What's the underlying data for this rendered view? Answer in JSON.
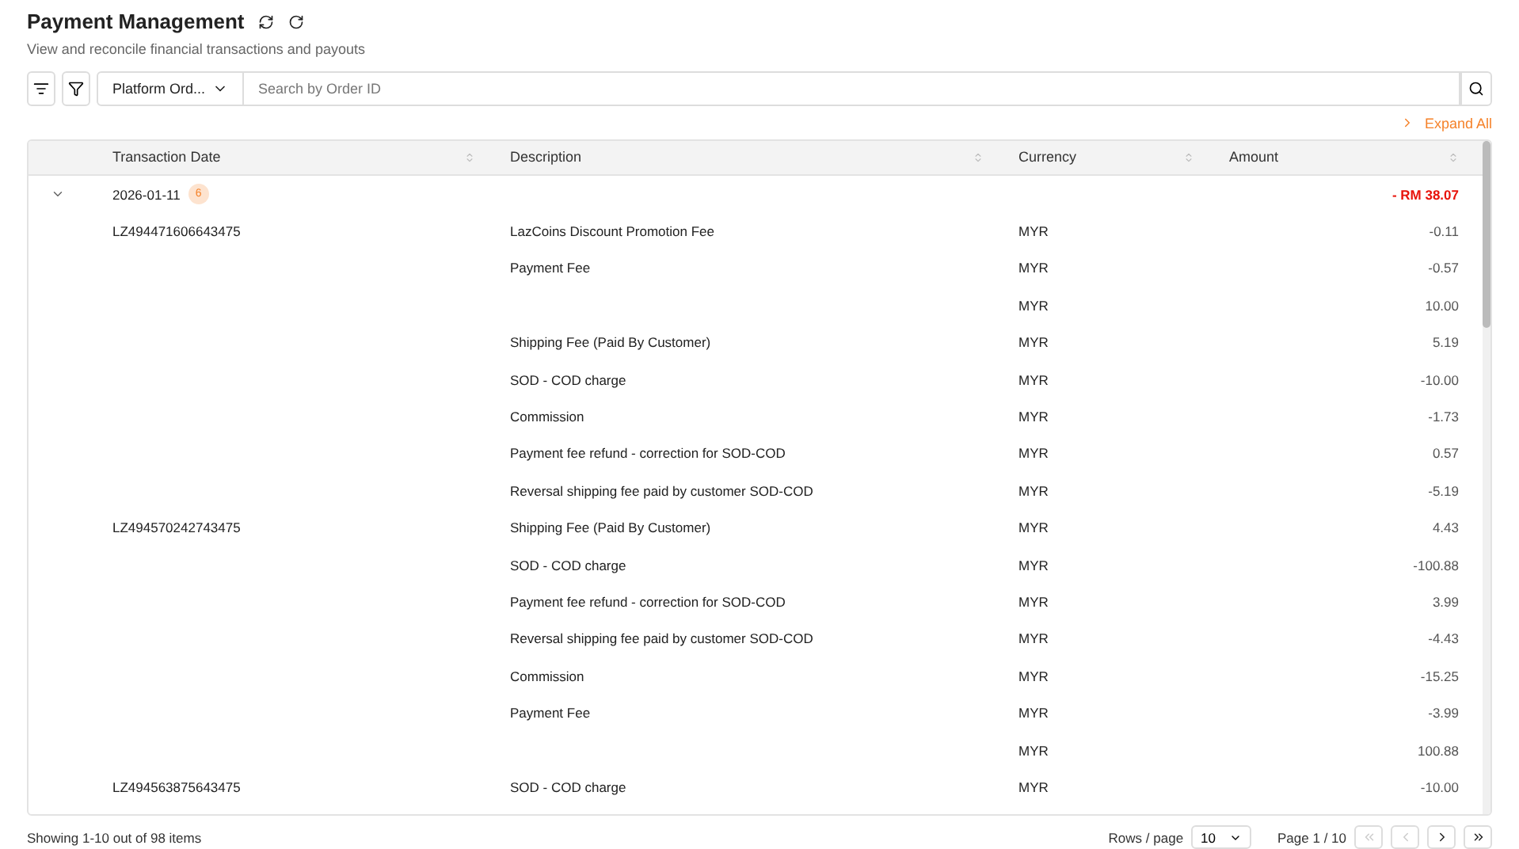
{
  "header": {
    "title": "Payment Management",
    "subtitle": "View and reconcile financial transactions and payouts"
  },
  "toolbar": {
    "dropdown": "Platform Ord...",
    "search": {
      "placeholder": "Search by Order ID"
    },
    "expand_all": "Expand All"
  },
  "table": {
    "columns": [
      "Transaction Date",
      "Description",
      "Currency",
      "Amount"
    ],
    "group": {
      "date": "2026-01-11",
      "count": "6",
      "total": "- RM 38.07",
      "expanded": true
    },
    "rows": [
      {
        "order_id": "LZ494471606643475",
        "description": "LazCoins Discount Promotion Fee",
        "currency": "MYR",
        "amount": "-0.11"
      },
      {
        "order_id": "",
        "description": "Payment Fee",
        "currency": "MYR",
        "amount": "-0.57"
      },
      {
        "order_id": "",
        "description": "",
        "currency": "MYR",
        "amount": "10.00"
      },
      {
        "order_id": "",
        "description": "Shipping Fee (Paid By Customer)",
        "currency": "MYR",
        "amount": "5.19"
      },
      {
        "order_id": "",
        "description": "SOD - COD charge",
        "currency": "MYR",
        "amount": "-10.00"
      },
      {
        "order_id": "",
        "description": "Commission",
        "currency": "MYR",
        "amount": "-1.73"
      },
      {
        "order_id": "",
        "description": "Payment fee refund - correction for SOD-COD",
        "currency": "MYR",
        "amount": "0.57"
      },
      {
        "order_id": "",
        "description": "Reversal shipping fee paid by customer SOD-COD",
        "currency": "MYR",
        "amount": "-5.19"
      },
      {
        "order_id": "LZ494570242743475",
        "description": "Shipping Fee (Paid By Customer)",
        "currency": "MYR",
        "amount": "4.43"
      },
      {
        "order_id": "",
        "description": "SOD - COD charge",
        "currency": "MYR",
        "amount": "-100.88"
      },
      {
        "order_id": "",
        "description": "Payment fee refund - correction for SOD-COD",
        "currency": "MYR",
        "amount": "3.99"
      },
      {
        "order_id": "",
        "description": "Reversal shipping fee paid by customer SOD-COD",
        "currency": "MYR",
        "amount": "-4.43"
      },
      {
        "order_id": "",
        "description": "Commission",
        "currency": "MYR",
        "amount": "-15.25"
      },
      {
        "order_id": "",
        "description": "Payment Fee",
        "currency": "MYR",
        "amount": "-3.99"
      },
      {
        "order_id": "",
        "description": "",
        "currency": "MYR",
        "amount": "100.88"
      },
      {
        "order_id": "LZ494563875643475",
        "description": "SOD - COD charge",
        "currency": "MYR",
        "amount": "-10.00"
      }
    ]
  },
  "footer": {
    "summary": "Showing 1-10 out of 98 items",
    "rows_label": "Rows / page",
    "rows_value": "10",
    "page": "Page 1 / 10",
    "first_disabled": true,
    "prev_disabled": true,
    "next_disabled": false,
    "last_disabled": false
  }
}
